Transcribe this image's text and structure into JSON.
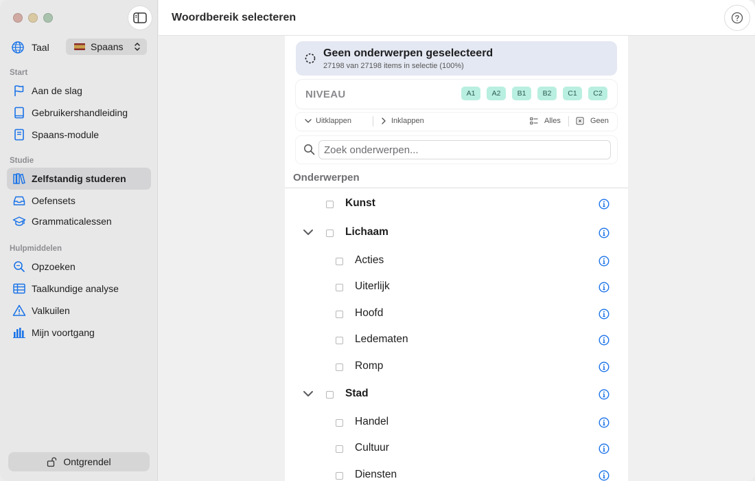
{
  "window": {
    "title": "Woordbereik selecteren"
  },
  "sidebar": {
    "language_label": "Taal",
    "language_value": "Spaans",
    "sections": [
      {
        "title": "Start"
      },
      {
        "title": "Studie"
      },
      {
        "title": "Hulpmiddelen"
      }
    ],
    "items": [
      {
        "label": "Aan de slag",
        "icon": "flag-icon"
      },
      {
        "label": "Gebruikershandleiding",
        "icon": "book-icon"
      },
      {
        "label": "Spaans-module",
        "icon": "module-book-icon"
      },
      {
        "label": "Zelfstandig studeren",
        "icon": "books-icon",
        "active": true
      },
      {
        "label": "Oefensets",
        "icon": "tray-icon"
      },
      {
        "label": "Grammaticalessen",
        "icon": "graduation-cap-icon"
      },
      {
        "label": "Opzoeken",
        "icon": "magnifier-icon"
      },
      {
        "label": "Taalkundige analyse",
        "icon": "table-icon"
      },
      {
        "label": "Valkuilen",
        "icon": "warning-icon"
      },
      {
        "label": "Mijn voortgang",
        "icon": "bar-chart-icon"
      }
    ],
    "unlock_label": "Ontgrendel"
  },
  "selection": {
    "title": "Geen onderwerpen geselecteerd",
    "subtitle": "27198 van 27198 items in selectie (100%)"
  },
  "levels": {
    "title": "NIVEAU",
    "items": [
      "A1",
      "A2",
      "B1",
      "B2",
      "C1",
      "C2"
    ]
  },
  "toolbar": {
    "expand": "Uitklappen",
    "collapse": "Inklappen",
    "all": "Alles",
    "none": "Geen"
  },
  "search": {
    "placeholder": "Zoek onderwerpen..."
  },
  "topics": {
    "header": "Onderwerpen",
    "rows": [
      {
        "label": "Kunst",
        "level": 0,
        "expandable": false
      },
      {
        "label": "Lichaam",
        "level": 0,
        "expandable": true
      },
      {
        "label": "Acties",
        "level": 1
      },
      {
        "label": "Uiterlijk",
        "level": 1
      },
      {
        "label": "Hoofd",
        "level": 1
      },
      {
        "label": "Ledematen",
        "level": 1
      },
      {
        "label": "Romp",
        "level": 1
      },
      {
        "label": "Stad",
        "level": 0,
        "expandable": true
      },
      {
        "label": "Handel",
        "level": 1
      },
      {
        "label": "Cultuur",
        "level": 1
      },
      {
        "label": "Diensten",
        "level": 1
      }
    ]
  },
  "colors": {
    "accent": "#1a73e8",
    "level_chip": "#b9efe0",
    "selection_card": "#e4e8f2"
  }
}
